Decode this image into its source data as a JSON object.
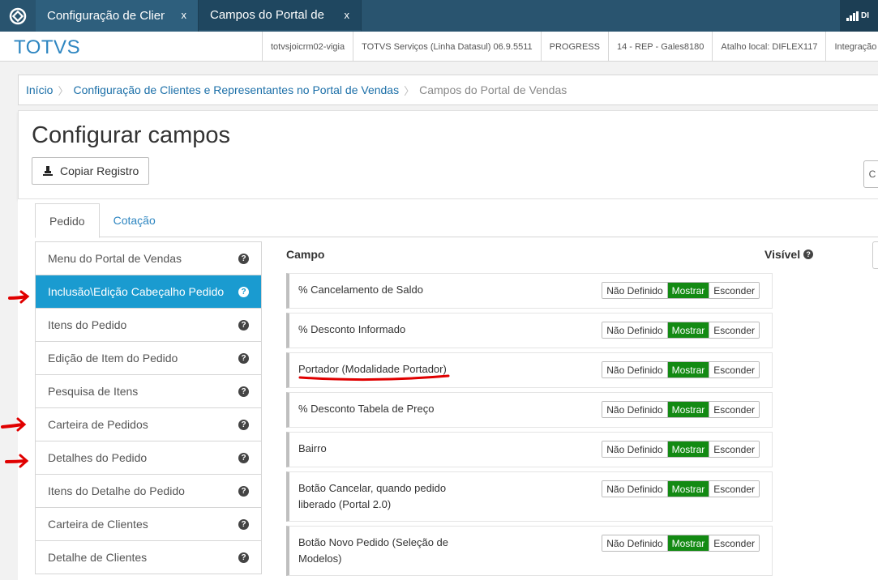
{
  "window_tabs": [
    {
      "title": "Configuração de Clien",
      "close": "x"
    },
    {
      "title": "Campos do Portal de Vendas",
      "close": "x"
    }
  ],
  "signal_label": "DI",
  "brand": "TOTVS",
  "info": [
    "totvsjoicrm02-vigia",
    "TOTVS Serviços (Linha Datasul) 06.9.5511",
    "PROGRESS",
    "14 - REP - Gales8180",
    "Atalho local: DIFLEX117",
    "Integração"
  ],
  "breadcrumb": {
    "home": "Início",
    "parent": "Configuração de Clientes e Representantes no Portal de Vendas",
    "current": "Campos do Portal de Vendas"
  },
  "page": {
    "title": "Configurar campos",
    "copy_button": "Copiar Registro",
    "right_button": "C"
  },
  "tabs": [
    {
      "label": "Pedido",
      "active": true
    },
    {
      "label": "Cotação",
      "active": false
    }
  ],
  "menu": [
    {
      "label": "Menu do Portal de Vendas",
      "active": false
    },
    {
      "label": "Inclusão\\Edição Cabeçalho Pedido",
      "active": true
    },
    {
      "label": "Itens do Pedido",
      "active": false
    },
    {
      "label": "Edição de Item do Pedido",
      "active": false
    },
    {
      "label": "Pesquisa de Itens",
      "active": false
    },
    {
      "label": "Carteira de Pedidos",
      "active": false
    },
    {
      "label": "Detalhes do Pedido",
      "active": false
    },
    {
      "label": "Itens do Detalhe do Pedido",
      "active": false
    },
    {
      "label": "Carteira de Clientes",
      "active": false
    },
    {
      "label": "Detalhe de Clientes",
      "active": false
    }
  ],
  "fields_header": {
    "campo": "Campo",
    "visivel": "Visível"
  },
  "options": [
    "Não Definido",
    "Mostrar",
    "Esconder"
  ],
  "fields": [
    {
      "line1": "% Cancelamento de Saldo",
      "line2": "",
      "selected": "Mostrar"
    },
    {
      "line1": "% Desconto Informado",
      "line2": "",
      "selected": "Mostrar"
    },
    {
      "line1": "Portador (Modalidade Portador)",
      "line2": "",
      "selected": "Mostrar"
    },
    {
      "line1": "% Desconto Tabela de Preço",
      "line2": "",
      "selected": "Mostrar"
    },
    {
      "line1": "Bairro",
      "line2": "",
      "selected": "Mostrar"
    },
    {
      "line1": "Botão Cancelar, quando pedido",
      "line2": "liberado (Portal 2.0)",
      "selected": "Mostrar"
    },
    {
      "line1": "Botão Novo Pedido (Seleção de",
      "line2": "Modelos)",
      "selected": "Mostrar"
    }
  ],
  "colors": {
    "topbar": "#29546f",
    "active_menu": "#1a9bd0",
    "mostrar": "#138a13",
    "annotation": "#e00000"
  }
}
